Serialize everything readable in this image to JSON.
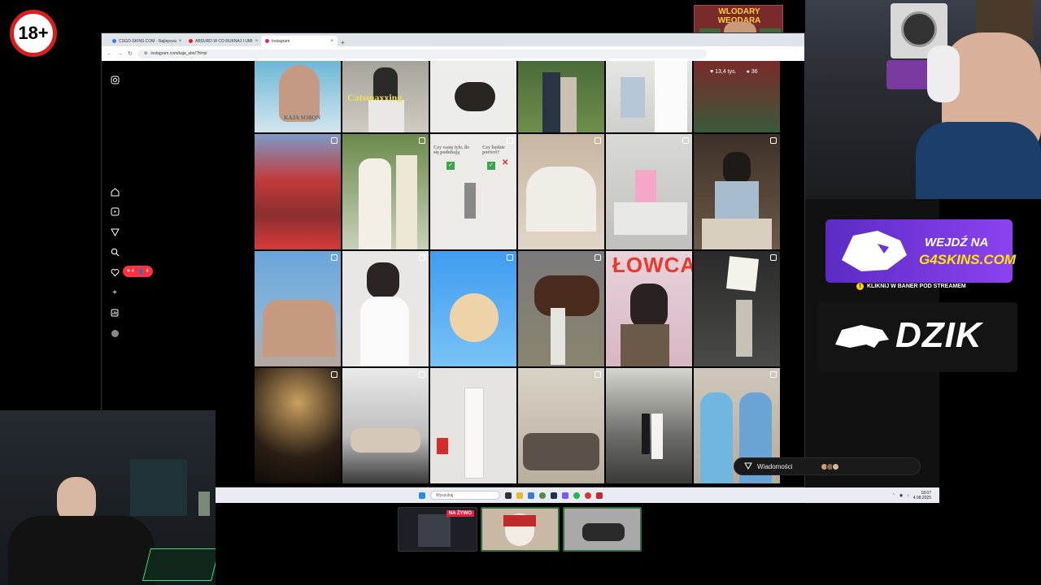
{
  "overlay": {
    "age_badge": "18+",
    "sticker_title": "WLODARY WEODARA"
  },
  "browser": {
    "tabs": [
      {
        "label": "CSGO-SKINS.COM - Najlepsza",
        "color": "#3d7be0",
        "active": false
      },
      {
        "label": "ABSURD W CO RUKNAJ I UMI",
        "color": "#e02020",
        "active": false
      },
      {
        "label": "Instagram",
        "color": "#d62976",
        "active": true
      }
    ],
    "url": "instagram.com/kaja_sbn/?hl=pl"
  },
  "instagram": {
    "sidebar_icons": [
      "instagram-logo-icon",
      "home-icon",
      "reels-icon",
      "explore-icon",
      "search-icon",
      "heart-icon",
      "create-icon",
      "dashboard-icon",
      "profile-icon"
    ],
    "notifications": {
      "likes": "4",
      "follows": "4"
    },
    "post_stats": {
      "likes": "13,4 tys.",
      "comments": "36"
    },
    "captions": {
      "catsmaxxing": "Catsmaxxing",
      "book_author": "KAJA SOBON",
      "lowca": "ŁOWCA",
      "poll_left": "Czy ważę tyle, ile się podobają",
      "poll_right": "Czy będzie portret?"
    },
    "messages_label": "Wiadomości"
  },
  "taskbar": {
    "search_placeholder": "Wyszukaj",
    "time": "18:07",
    "date": "4.08.2025"
  },
  "stream": {
    "live_label": "NA ŻYWO",
    "g4_line1": "WEJDŹ NA",
    "g4_line2": "G4SKINS.COM",
    "g4_sub": "KLIKNIJ W BANER POD STREAMEM",
    "dzik": "DZIK"
  }
}
